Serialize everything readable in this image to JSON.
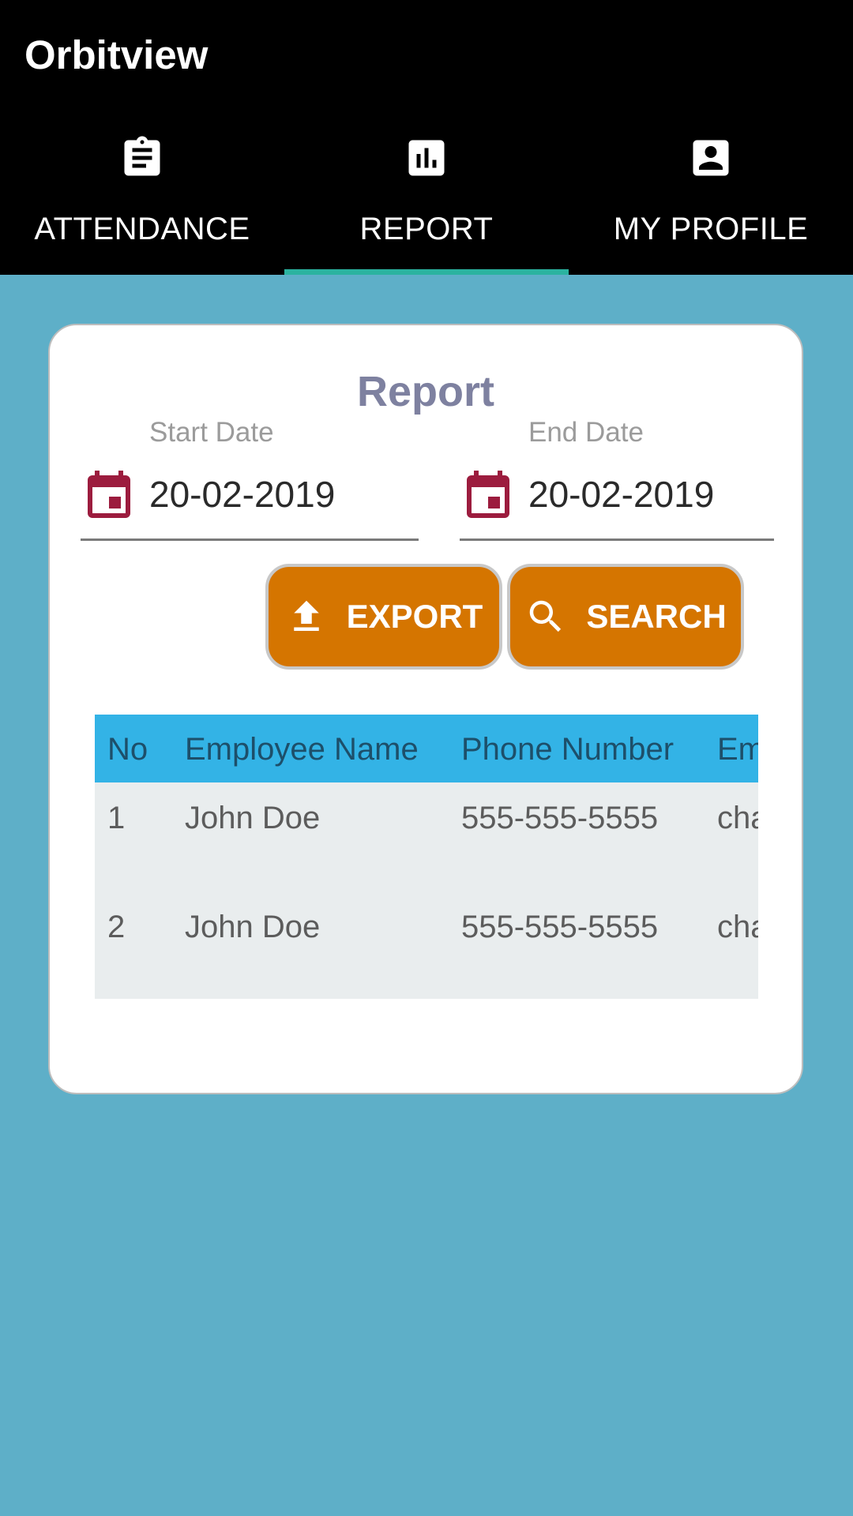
{
  "app": {
    "title": "Orbitview"
  },
  "tabs": [
    {
      "label": "ATTENDANCE",
      "icon": "clipboard-icon",
      "selected": false
    },
    {
      "label": "REPORT",
      "icon": "bar-chart-icon",
      "selected": true
    },
    {
      "label": "MY PROFILE",
      "icon": "account-box-icon",
      "selected": false
    }
  ],
  "report": {
    "title": "Report",
    "start_date": {
      "label": "Start Date",
      "value": "20-02-2019",
      "icon": "calendar-icon"
    },
    "end_date": {
      "label": "End Date",
      "value": "20-02-2019",
      "icon": "calendar-icon"
    },
    "export_label": "EXPORT",
    "search_label": "SEARCH",
    "table": {
      "headers": [
        "No",
        "Employee Name",
        "Phone Number",
        "Em"
      ],
      "rows": [
        [
          "1",
          "John Doe",
          "555-555-5555",
          "cha"
        ],
        [
          "2",
          "John Doe",
          "555-555-5555",
          "cha"
        ]
      ]
    }
  },
  "colors": {
    "background": "#5eafc8",
    "appbar": "#000000",
    "tab_indicator": "#2bb3a0",
    "title": "#7e81a0",
    "button": "#d57500",
    "table_header": "#33b3e6",
    "table_body": "#e9edee",
    "calendar_icon": "#9c1c3e"
  }
}
